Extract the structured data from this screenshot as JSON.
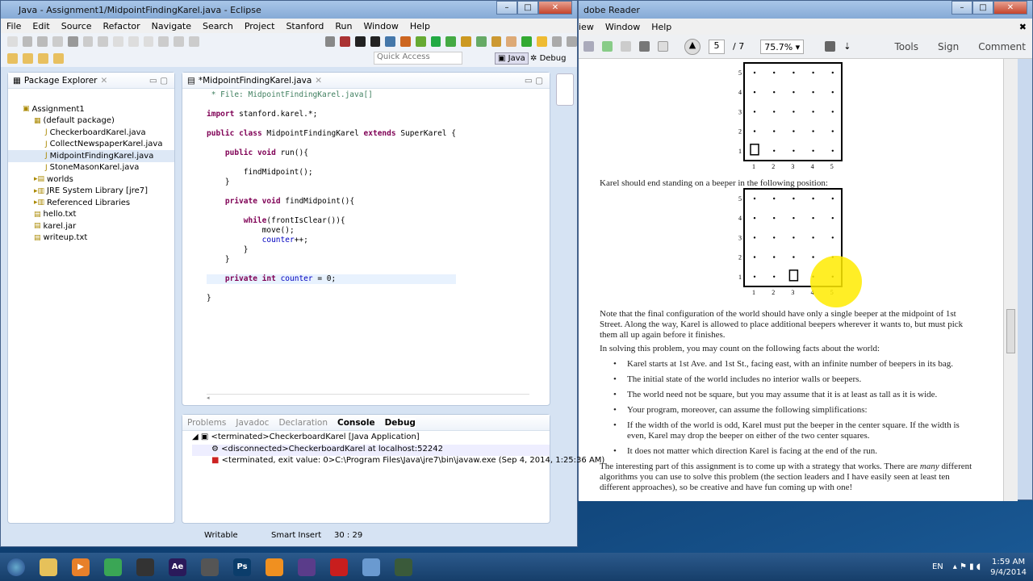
{
  "eclipse": {
    "title": "Java - Assignment1/MidpointFindingKarel.java - Eclipse",
    "menu": [
      "File",
      "Edit",
      "Source",
      "Refactor",
      "Navigate",
      "Search",
      "Project",
      "Stanford",
      "Run",
      "Window",
      "Help"
    ],
    "quick_access_placeholder": "Quick Access",
    "perspectives": [
      "Java",
      "Debug"
    ],
    "package_explorer": {
      "title": "Package Explorer",
      "items": [
        "Assignment1",
        "(default package)",
        "CheckerboardKarel.java",
        "CollectNewspaperKarel.java",
        "MidpointFindingKarel.java",
        "StoneMasonKarel.java",
        "worlds",
        "JRE System Library [jre7]",
        "Referenced Libraries",
        "hello.txt",
        "karel.jar",
        "writeup.txt"
      ]
    },
    "editor": {
      "tab": "*MidpointFindingKarel.java",
      "lines": [
        {
          "t": " * File: MidpointFindingKarel.java[]",
          "c": "cm"
        },
        {
          "t": "",
          "c": ""
        },
        {
          "t": "import stanford.karel.*;",
          "c": "imp"
        },
        {
          "t": "",
          "c": ""
        },
        {
          "t": "public class MidpointFindingKarel extends SuperKarel {",
          "c": "cls"
        },
        {
          "t": "",
          "c": ""
        },
        {
          "t": "    public void run(){",
          "c": "m1"
        },
        {
          "t": "",
          "c": ""
        },
        {
          "t": "        findMidpoint();",
          "c": ""
        },
        {
          "t": "    }",
          "c": ""
        },
        {
          "t": "",
          "c": ""
        },
        {
          "t": "    private void findMidpoint(){",
          "c": "m2"
        },
        {
          "t": "",
          "c": ""
        },
        {
          "t": "        while(frontIsClear()){",
          "c": "wh"
        },
        {
          "t": "            move();",
          "c": ""
        },
        {
          "t": "            counter++;",
          "c": "cnt"
        },
        {
          "t": "        }",
          "c": ""
        },
        {
          "t": "    }",
          "c": ""
        },
        {
          "t": "",
          "c": ""
        },
        {
          "t": "    private int counter = 0;",
          "c": "fld"
        },
        {
          "t": "",
          "c": ""
        },
        {
          "t": "}",
          "c": ""
        }
      ]
    },
    "bottom_tabs": [
      "Problems",
      "Javadoc",
      "Declaration",
      "Console",
      "Debug"
    ],
    "debug": [
      "<terminated>CheckerboardKarel [Java Application]",
      "<disconnected>CheckerboardKarel at localhost:52242",
      "<terminated, exit value: 0>C:\\Program Files\\Java\\jre7\\bin\\javaw.exe (Sep 4, 2014, 1:25:36 AM)"
    ],
    "status": {
      "mode": "Writable",
      "insert": "Smart Insert",
      "position": "30 : 29"
    }
  },
  "reader": {
    "title": "dobe Reader",
    "menu": [
      "iew",
      "Window",
      "Help"
    ],
    "page": "5",
    "pages": "/ 7",
    "zoom": "75.7%",
    "tools": [
      "Tools",
      "Sign",
      "Comment"
    ],
    "grid_labels": [
      "1",
      "2",
      "3",
      "4",
      "5"
    ],
    "caption": "Karel should end standing on a beeper in the following position:",
    "para1": "Note that the final configuration of the world should have only a single beeper at the midpoint of 1st Street. Along the way, Karel is allowed to place additional beepers wherever it wants to, but must pick them all up again before it finishes.",
    "para2": "In solving this problem, you may count on the following facts about the world:",
    "bullets": [
      "Karel starts at 1st Ave. and 1st St., facing east, with an infinite number of beepers in its bag.",
      "The initial state of the world includes no interior walls or beepers.",
      "The world need not be square, but you may assume that it is at least as tall as it is wide.",
      "Your program, moreover, can assume the following simplifications:",
      "If the width of the world is odd, Karel must put the beeper in the center square. If the width is even, Karel may drop the beeper on either of the two center squares.",
      "It does not matter which direction Karel is facing at the end of the run."
    ],
    "para3a": "The interesting part of this assignment is to come up with a strategy that works. There are ",
    "para3em": "many",
    "para3b": " different algorithms you can use to solve this problem (the section leaders and I have easily seen at least ten different approaches), so be creative and have fun coming up with one!"
  },
  "taskbar": {
    "lang": "EN",
    "time": "1:59 AM",
    "date": "9/4/2014",
    "apps": [
      {
        "n": "explorer",
        "c": "#e6c15a",
        "l": ""
      },
      {
        "n": "media-player",
        "c": "#e8802a",
        "l": "▶"
      },
      {
        "n": "chrome",
        "c": "#3aa655",
        "l": ""
      },
      {
        "n": "steam",
        "c": "#333",
        "l": ""
      },
      {
        "n": "after-effects",
        "c": "#2a1a5a",
        "l": "Ae"
      },
      {
        "n": "movie-maker",
        "c": "#555",
        "l": ""
      },
      {
        "n": "photoshop",
        "c": "#0b3d6b",
        "l": "Ps"
      },
      {
        "n": "orange-app",
        "c": "#f09020",
        "l": ""
      },
      {
        "n": "eclipse",
        "c": "#5a3c8a",
        "l": ""
      },
      {
        "n": "adobe-reader",
        "c": "#c81e1e",
        "l": ""
      },
      {
        "n": "paint",
        "c": "#6a9ad0",
        "l": ""
      },
      {
        "n": "karel",
        "c": "#3a5a3a",
        "l": ""
      }
    ]
  }
}
